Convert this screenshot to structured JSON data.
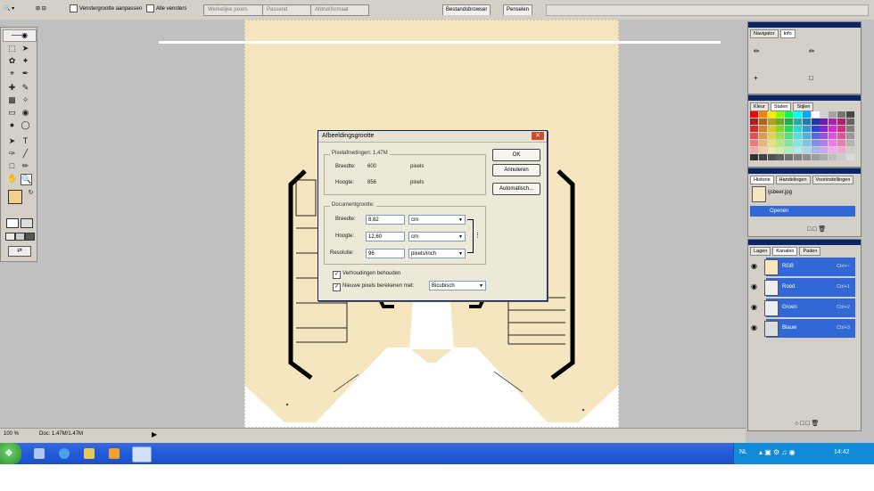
{
  "options_bar": {
    "checkbox_1_label": "Venstergrootte aanpassen",
    "checkbox_2_label": "Alle vensters",
    "btn_actual_pixels": "Werkelijke pixels",
    "btn_fit_screen": "Passend",
    "btn_print_size": "Afdrukformaat",
    "tab_browser": "Bestandsbrowser",
    "tab_brushes": "Penselen"
  },
  "statusbar": {
    "zoom": "100 %",
    "doc_info": "Doc: 1.47M/1.47M"
  },
  "dialog": {
    "title": "Afbeeldingsgrootte",
    "ok": "OK",
    "cancel": "Annuleren",
    "auto": "Automatisch...",
    "pixel_dimensions_legend": "Pixelafmetingen: 1,47M",
    "px_width_label": "Breedte:",
    "px_width_value": "600",
    "px_width_unit": "pixels",
    "px_height_label": "Hoogte:",
    "px_height_value": "856",
    "px_height_unit": "pixels",
    "doc_size_legend": "Documentgrootte:",
    "doc_width_label": "Breedte:",
    "doc_width_value": "8,82",
    "doc_width_unit": "cm",
    "doc_height_label": "Hoogte:",
    "doc_height_value": "12,60",
    "doc_height_unit": "cm",
    "resolution_label": "Resolutie:",
    "resolution_value": "96",
    "resolution_unit": "pixels/inch",
    "constrain_label": "Verhoudingen behouden",
    "resample_label": "Nieuwe pixels berekenen met:",
    "resample_value": "Bicubisch"
  },
  "nav_panel": {
    "tab_navigator": "Navigator",
    "tab_info": "Info"
  },
  "swatch_panel": {
    "tab_color": "Kleur",
    "tab_swatches": "Stalen",
    "tab_styles": "Stijlen"
  },
  "history_panel": {
    "tab_history": "Historie",
    "tab_actions": "Handelingen",
    "tab_tool_presets": "Voorinstellingen",
    "snapshot_name": "ijsbeer.jpg",
    "step_open": "Openen"
  },
  "layers_panel": {
    "tab_layers": "Lagen",
    "tab_channels": "Kanalen",
    "tab_paths": "Paden",
    "rows": [
      {
        "name": "RGB",
        "shortcut": "Ctrl+~"
      },
      {
        "name": "Rood",
        "shortcut": "Ctrl+1"
      },
      {
        "name": "Groen",
        "shortcut": "Ctrl+2"
      },
      {
        "name": "Blauw",
        "shortcut": "Ctrl+3"
      }
    ]
  },
  "taskbar": {
    "lang": "NL",
    "clock": "14:42"
  },
  "colors": {
    "canvas": "#f6e6c0",
    "selection_blue": "#3168d5",
    "taskbar_blue": "#245edb",
    "foreground_swatch": "#f2cf8e"
  }
}
